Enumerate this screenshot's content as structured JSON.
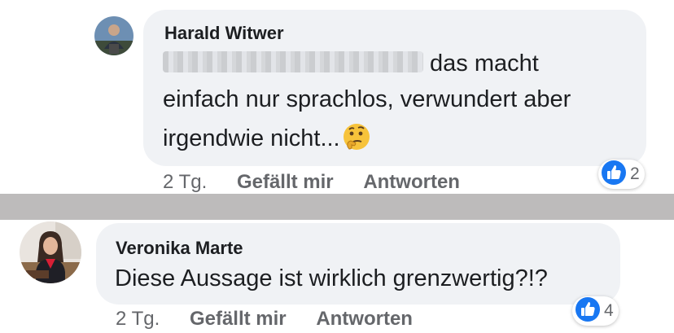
{
  "comments": [
    {
      "author": "Harald Witwer",
      "text_line1_rest": "das macht",
      "text_line2": "einfach nur sprachlos, verwundert aber",
      "text_line3": "irgendwie nicht...",
      "emoji": "thinking-face",
      "time": "2 Tg.",
      "like_label": "Gefällt mir",
      "reply_label": "Antworten",
      "reaction_count": "2",
      "reaction_color": "#1877f2"
    },
    {
      "author": "Veronika Marte",
      "text": "Diese Aussage ist wirklich grenzwertig?!?",
      "time": "2 Tg.",
      "like_label": "Gefällt mir",
      "reply_label": "Antworten",
      "reaction_count": "4",
      "reaction_color": "#1877f2"
    }
  ],
  "colors": {
    "bubble": "#f0f2f5",
    "meta_text": "#65676b",
    "separator": "#bdbbbb"
  }
}
